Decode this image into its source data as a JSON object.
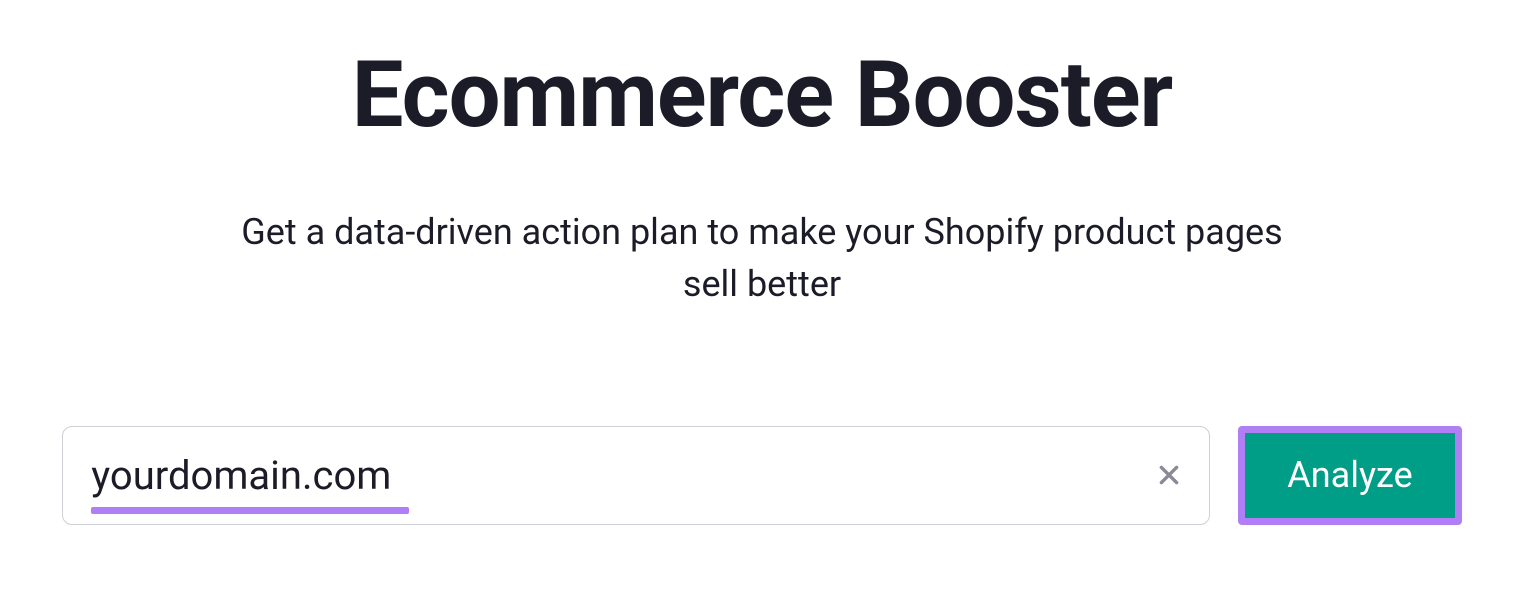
{
  "header": {
    "title": "Ecommerce Booster",
    "subtitle": "Get a data-driven action plan to make your Shopify product pages sell better"
  },
  "form": {
    "domain_value": "yourdomain.com",
    "analyze_label": "Analyze"
  },
  "colors": {
    "highlight": "#b07ff5",
    "primary_button": "#009e87",
    "text": "#1c1c28"
  }
}
